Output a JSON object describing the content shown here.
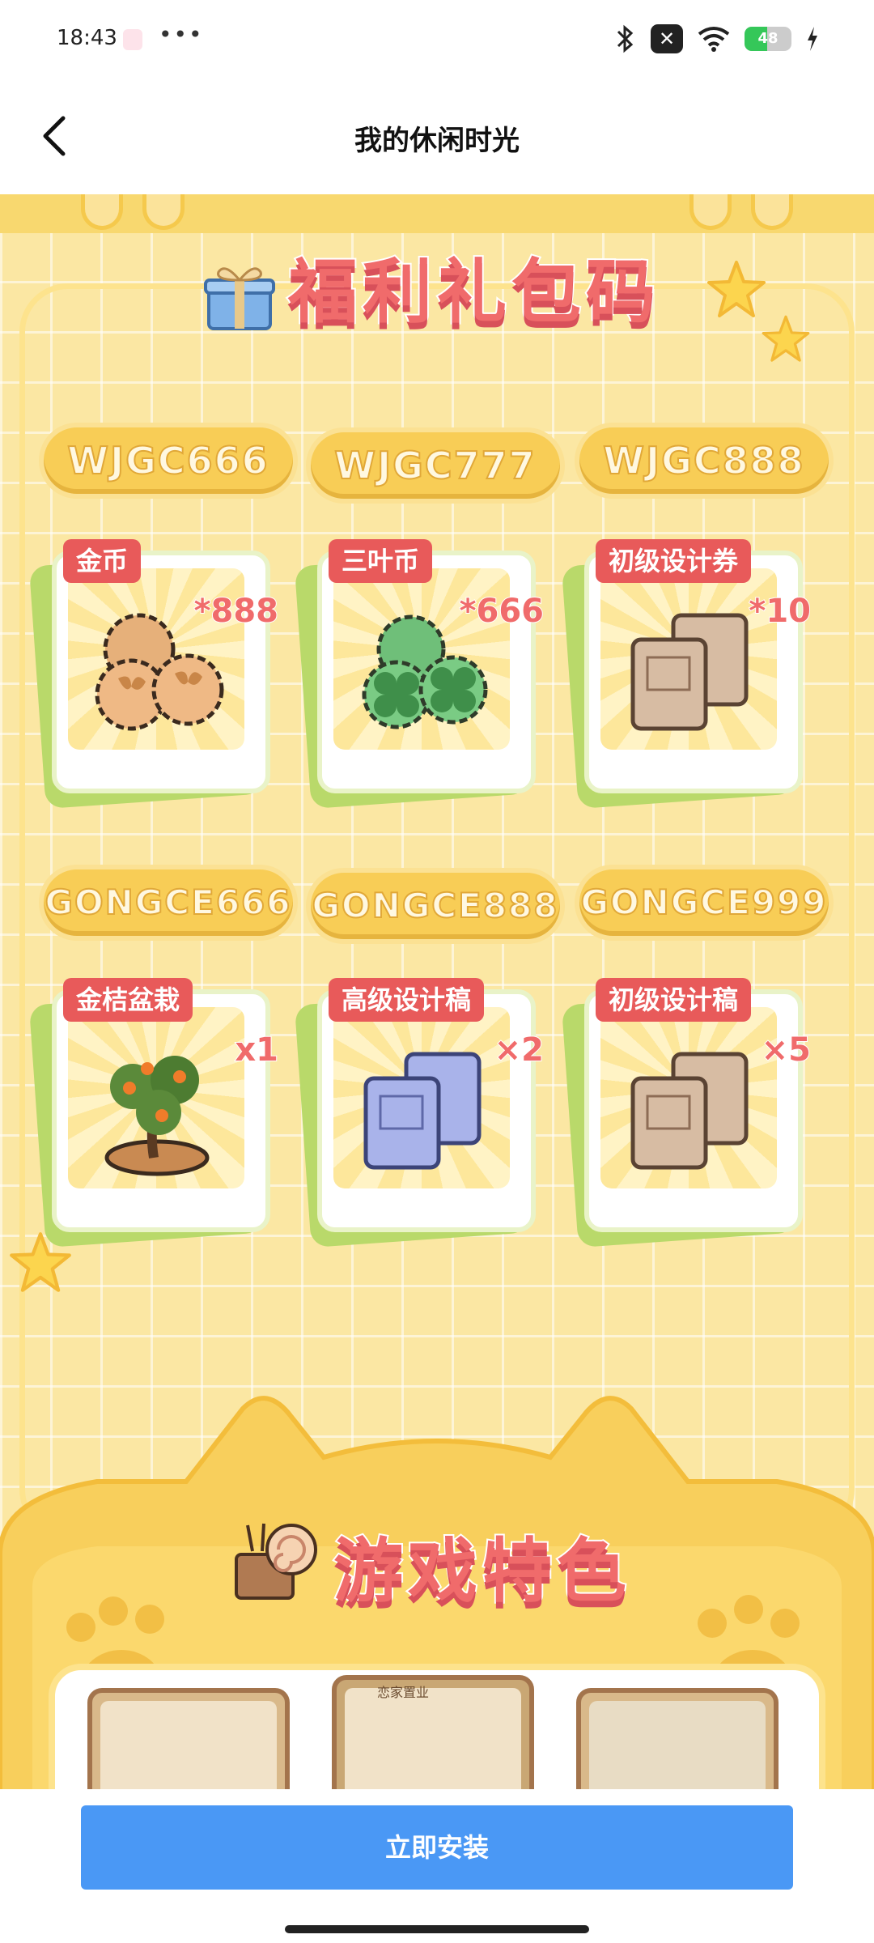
{
  "status_bar": {
    "time": "18:43",
    "battery_level": 48,
    "battery_text": "48",
    "icons": [
      "app-notification-icon",
      "more-dots-icon",
      "bluetooth-icon",
      "muted-app-icon",
      "wifi-icon",
      "battery-icon",
      "charging-icon"
    ]
  },
  "header": {
    "title": "我的休闲时光",
    "back_icon": "chevron-left-icon"
  },
  "banner": {
    "title": "福利礼包码",
    "codes_row1": [
      "WJGC666",
      "WJGC777",
      "WJGC888"
    ],
    "codes_row2": [
      "GONGCE666",
      "GONGCE888",
      "GONGCE999"
    ],
    "rewards_row1": [
      {
        "name": "金币",
        "count": "*888",
        "icon": "gold-coins-icon"
      },
      {
        "name": "三叶币",
        "count": "*666",
        "icon": "clover-coins-icon"
      },
      {
        "name": "初级设计券",
        "count": "*10",
        "icon": "scroll-icon"
      }
    ],
    "rewards_row2": [
      {
        "name": "金桔盆栽",
        "count": "x1",
        "icon": "kumquat-bonsai-icon"
      },
      {
        "name": "高级设计稿",
        "count": "×2",
        "icon": "blue-scroll-icon"
      },
      {
        "name": "初级设计稿",
        "count": "×5",
        "icon": "scroll-icon"
      }
    ]
  },
  "features": {
    "title": "游戏特色",
    "thumb_label": "恋家置业"
  },
  "bottom": {
    "install_label": "立即安装"
  },
  "colors": {
    "accent_blue": "#4a98f5",
    "title_red": "#f06b6b",
    "banner_yellow": "#fbe7a3"
  }
}
